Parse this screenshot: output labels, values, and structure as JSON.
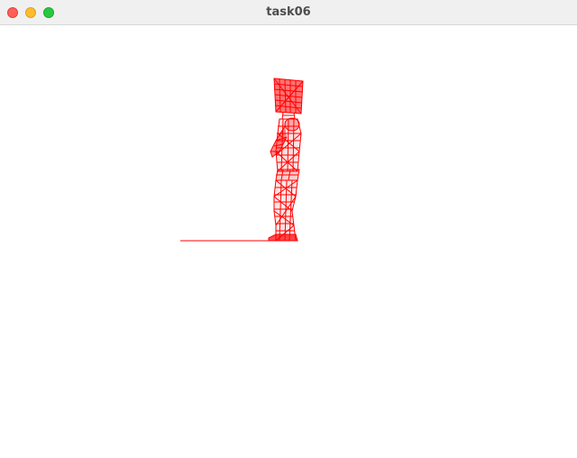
{
  "window": {
    "title": "task06"
  },
  "scene": {
    "wire_color": "#ff0000",
    "background": "#ffffff",
    "subject": "wireframe-human-figure-side-view"
  }
}
